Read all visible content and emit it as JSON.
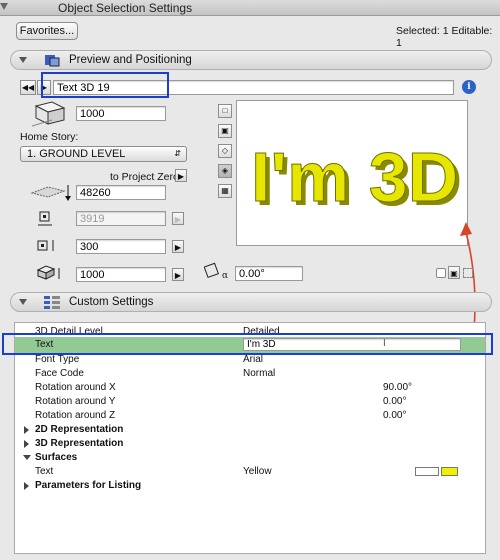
{
  "window": {
    "title": "Object Selection Settings"
  },
  "toolbar": {
    "favorites_label": "Favorites...",
    "selection_status": "Selected: 1 Editable: 1"
  },
  "preview_section": {
    "title": "Preview and Positioning",
    "object_name": "Text 3D 19",
    "height_value": "1000",
    "home_story_label": "Home Story:",
    "home_story_value": "1. GROUND LEVEL",
    "project_zero_label": "to Project Zero",
    "elevation_value": "48260",
    "x_size_value": "3919",
    "y_size_value": "300",
    "z_size_value": "1000",
    "angle_value": "0.00°",
    "preview_text": "I'm 3D"
  },
  "custom_section": {
    "title": "Custom Settings",
    "rows": [
      {
        "name": "3D Detail Level",
        "value": "Detailed"
      },
      {
        "name": "Text",
        "value": "I'm 3D"
      },
      {
        "name": "Font Type",
        "value": "Arial"
      },
      {
        "name": "Face Code",
        "value": "Normal"
      },
      {
        "name": "Rotation around X",
        "value": "90.00°"
      },
      {
        "name": "Rotation around Y",
        "value": "0.00°"
      },
      {
        "name": "Rotation around Z",
        "value": "0.00°"
      },
      {
        "name": "2D Representation",
        "value": ""
      },
      {
        "name": "3D Representation",
        "value": ""
      },
      {
        "name": "Surfaces",
        "value": ""
      },
      {
        "name": "Text",
        "value": "Yellow"
      },
      {
        "name": "Parameters for Listing",
        "value": ""
      }
    ]
  },
  "colors": {
    "highlight": "#1a3fd0",
    "text_3d": "#e6e600",
    "selected_row": "#93c993",
    "arrow": "#d8442a"
  }
}
